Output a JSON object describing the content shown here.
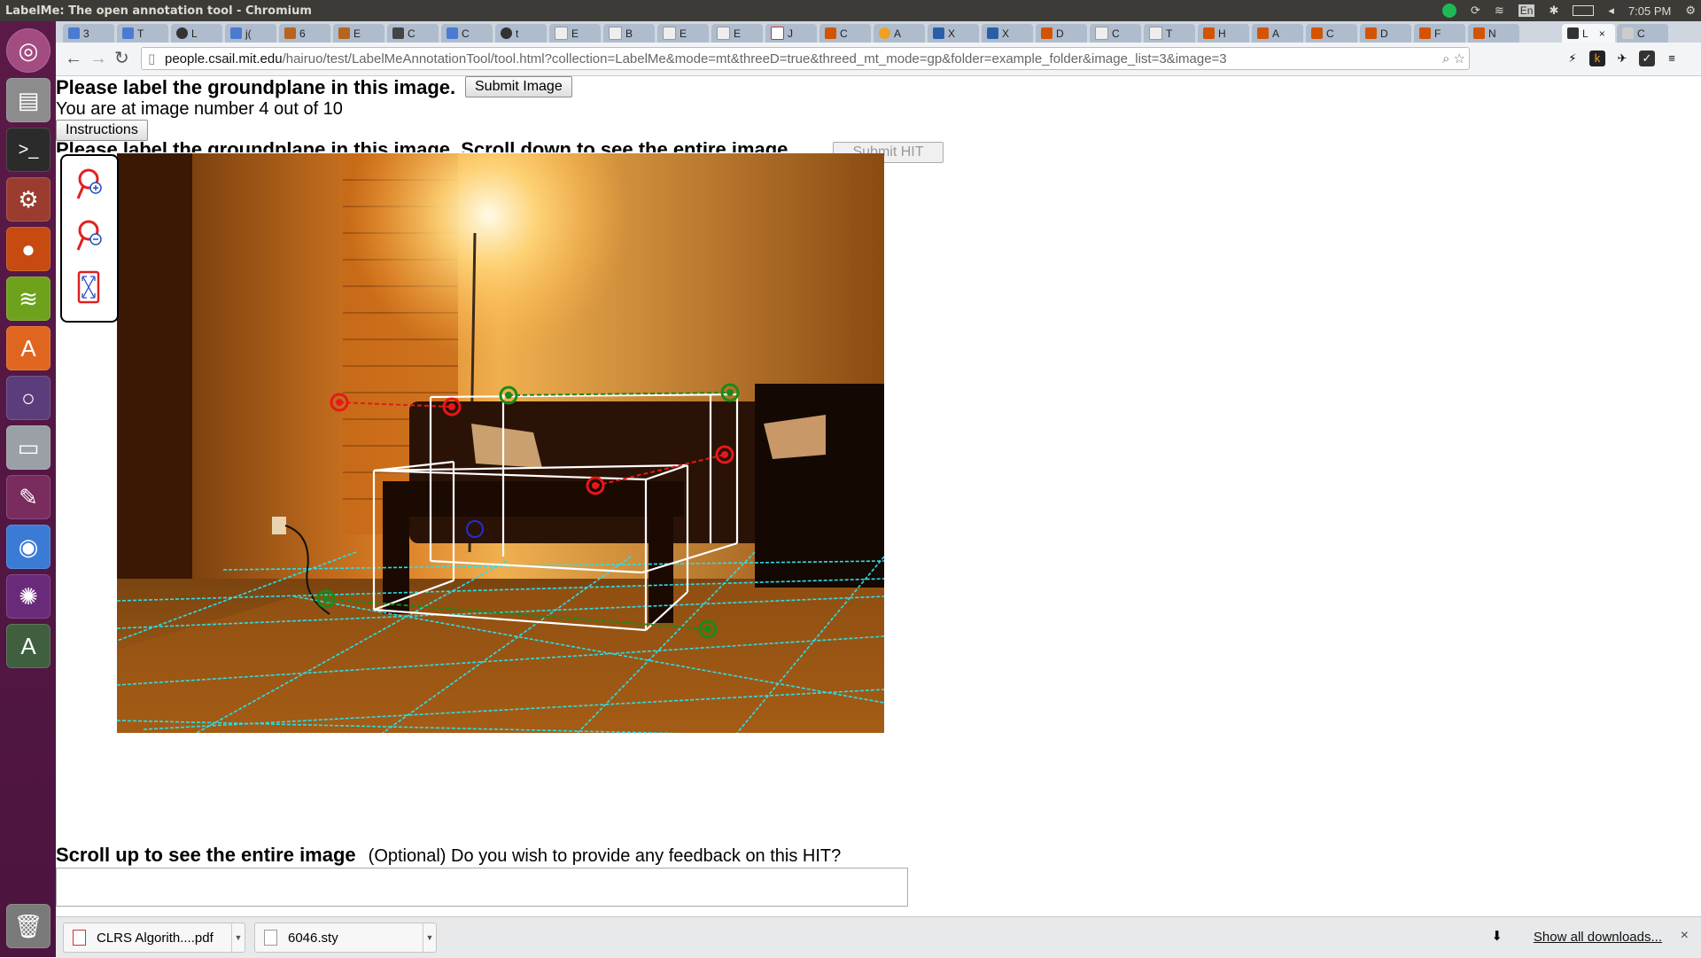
{
  "window": {
    "title": "LabelMe: The open annotation tool - Chromium"
  },
  "system_tray": {
    "keyboard": "En",
    "time": "7:05 PM"
  },
  "launcher": {
    "items": [
      "ubuntu-dash-icon",
      "files-icon",
      "terminal-icon",
      "settings-icon",
      "firefox-icon",
      "spotify-icon",
      "software-center-icon",
      "circle-app-icon",
      "drive-icon",
      "paint-icon",
      "chromium-icon",
      "shutter-icon",
      "update-manager-icon",
      "trash-icon"
    ]
  },
  "tabs": [
    {
      "label": "3"
    },
    {
      "label": "T"
    },
    {
      "label": "L"
    },
    {
      "label": "j("
    },
    {
      "label": "6"
    },
    {
      "label": "E"
    },
    {
      "label": "C"
    },
    {
      "label": "C"
    },
    {
      "label": "t"
    },
    {
      "label": "E"
    },
    {
      "label": "B"
    },
    {
      "label": "E"
    },
    {
      "label": "E"
    },
    {
      "label": "J"
    },
    {
      "label": "C"
    },
    {
      "label": "A"
    },
    {
      "label": "X"
    },
    {
      "label": "X"
    },
    {
      "label": "D"
    },
    {
      "label": "C"
    },
    {
      "label": "T"
    },
    {
      "label": "H"
    },
    {
      "label": "A"
    },
    {
      "label": "C"
    },
    {
      "label": "D"
    },
    {
      "label": "F"
    },
    {
      "label": "N"
    },
    {
      "label": "L"
    },
    {
      "label": "C"
    }
  ],
  "active_tab_close": "×",
  "address": {
    "host": "people.csail.mit.edu",
    "path": "/hairuo/test/LabelMeAnnotationTool/tool.html?collection=LabelMe&mode=mt&threeD=true&threed_mt_mode=gp&folder=example_folder&image_list=3&image=3"
  },
  "page": {
    "heading": "Please label the groundplane in this image.",
    "submit_image_label": "Submit Image",
    "image_counter": "You are at image number 4 out of 10",
    "instructions_label": "Instructions",
    "heading2": "Please label the groundplane in this image. Scroll down to see the entire image.",
    "submit_hit_label": "Submit HIT",
    "footer_heading": "Scroll up to see the entire image",
    "footer_question": "(Optional) Do you wish to provide any feedback on this HIT?",
    "feedback_value": ""
  },
  "tools": [
    "zoom-in-icon",
    "zoom-out-icon",
    "fit-to-screen-icon"
  ],
  "downloads": [
    {
      "name": "CLRS Algorith....pdf"
    },
    {
      "name": "6046.sty"
    }
  ],
  "download_shelf": {
    "show_all": "Show all downloads...",
    "close": "×"
  },
  "colors": {
    "grid": "#29e0e8",
    "box": "#ffffff",
    "point_red": "#e81818",
    "point_green": "#1a8a1a",
    "point_blue": "#2030d0"
  }
}
